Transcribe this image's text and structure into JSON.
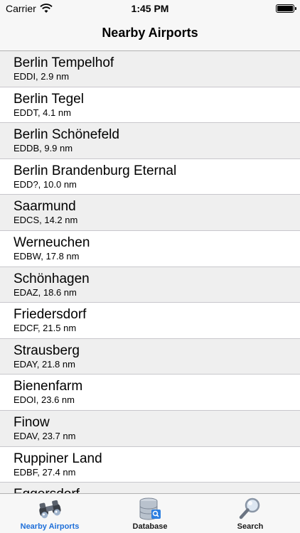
{
  "status": {
    "carrier": "Carrier",
    "time": "1:45 PM"
  },
  "header": {
    "title": "Nearby Airports"
  },
  "airports": [
    {
      "name": "Berlin Tempelhof",
      "detail": "EDDI, 2.9 nm"
    },
    {
      "name": "Berlin Tegel",
      "detail": "EDDT, 4.1 nm"
    },
    {
      "name": "Berlin Schönefeld",
      "detail": "EDDB, 9.9 nm"
    },
    {
      "name": "Berlin Brandenburg Eternal",
      "detail": "EDD?, 10.0 nm"
    },
    {
      "name": "Saarmund",
      "detail": "EDCS, 14.2 nm"
    },
    {
      "name": "Werneuchen",
      "detail": "EDBW, 17.8 nm"
    },
    {
      "name": "Schönhagen",
      "detail": "EDAZ, 18.6 nm"
    },
    {
      "name": "Friedersdorf",
      "detail": "EDCF, 21.5 nm"
    },
    {
      "name": "Strausberg",
      "detail": "EDAY, 21.8 nm"
    },
    {
      "name": "Bienenfarm",
      "detail": "EDOI, 23.6 nm"
    },
    {
      "name": "Finow",
      "detail": "EDAV, 23.7 nm"
    },
    {
      "name": "Ruppiner Land",
      "detail": "EDBF, 27.4 nm"
    },
    {
      "name": "Eggersdorf",
      "detail": ""
    }
  ],
  "tabs": [
    {
      "label": "Nearby Airports",
      "icon": "binoculars-icon",
      "active": true
    },
    {
      "label": "Database",
      "icon": "database-icon",
      "active": false
    },
    {
      "label": "Search",
      "icon": "magnifier-icon",
      "active": false
    }
  ],
  "colors": {
    "accent": "#1e6fd9",
    "row_alt": "#efefef",
    "bar": "#f7f7f7"
  }
}
